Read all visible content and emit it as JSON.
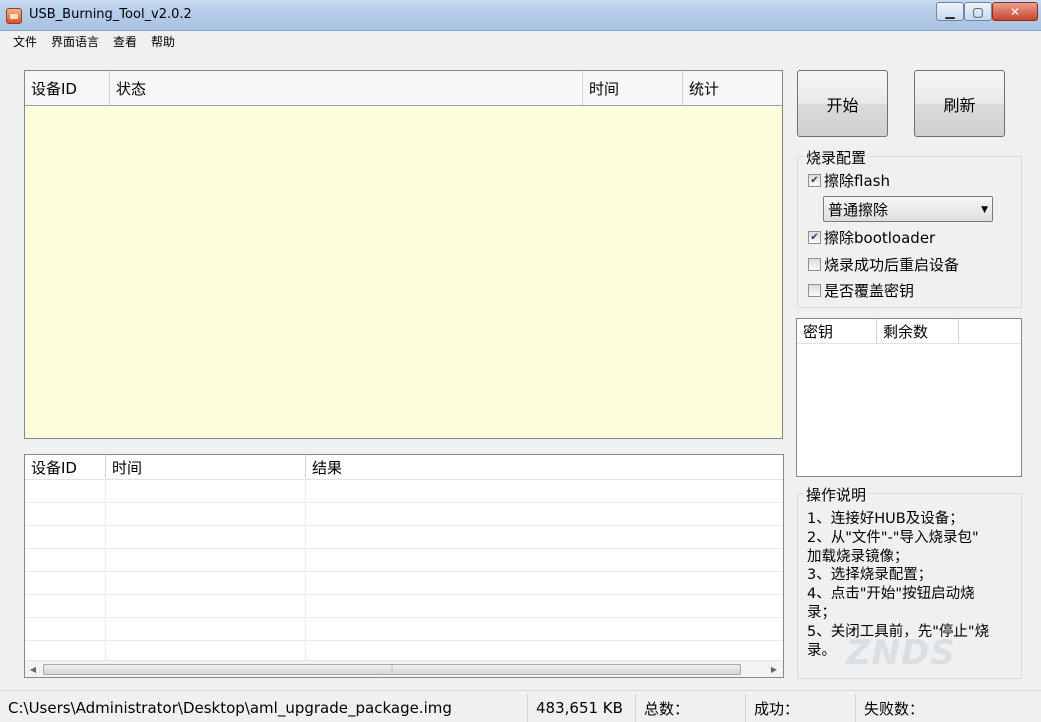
{
  "window": {
    "title": "USB_Burning_Tool_v2.0.2",
    "controls": {
      "minimize": "▁",
      "maximize": "▢",
      "close": "✕"
    }
  },
  "menu": [
    "文件",
    "界面语言",
    "查看",
    "帮助"
  ],
  "device_table": {
    "columns": [
      "设备ID",
      "状态",
      "时间",
      "统计"
    ],
    "rows": []
  },
  "result_table": {
    "columns": [
      "设备ID",
      "时间",
      "结果"
    ],
    "rows": [],
    "scroll_grip": "⦙"
  },
  "buttons": {
    "start": "开始",
    "refresh": "刷新"
  },
  "burn_config": {
    "title": "烧录配置",
    "erase_flash": {
      "label": "擦除flash",
      "checked": true
    },
    "erase_mode": {
      "selected": "普通擦除"
    },
    "erase_bootloader": {
      "label": "擦除bootloader",
      "checked": true
    },
    "reboot_after": {
      "label": "烧录成功后重启设备",
      "checked": false
    },
    "overwrite_key": {
      "label": "是否覆盖密钥",
      "checked": false
    }
  },
  "key_table": {
    "columns": [
      "密钥",
      "剩余数"
    ],
    "rows": []
  },
  "instructions": {
    "title": "操作说明",
    "lines": [
      "1、连接好HUB及设备；",
      "2、从\"文件\"-\"导入烧录包\"",
      "加载烧录镜像；",
      "3、选择烧录配置；",
      "4、点击\"开始\"按钮启动烧",
      "录；",
      "5、关闭工具前，先\"停止\"烧",
      "录。"
    ]
  },
  "status_bar": {
    "path": "C:\\Users\\Administrator\\Desktop\\aml_upgrade_package.img",
    "size": "483,651 KB",
    "total_label": "总数：",
    "success_label": "成功：",
    "fail_label": "失败数："
  },
  "watermark": "ZNDS"
}
